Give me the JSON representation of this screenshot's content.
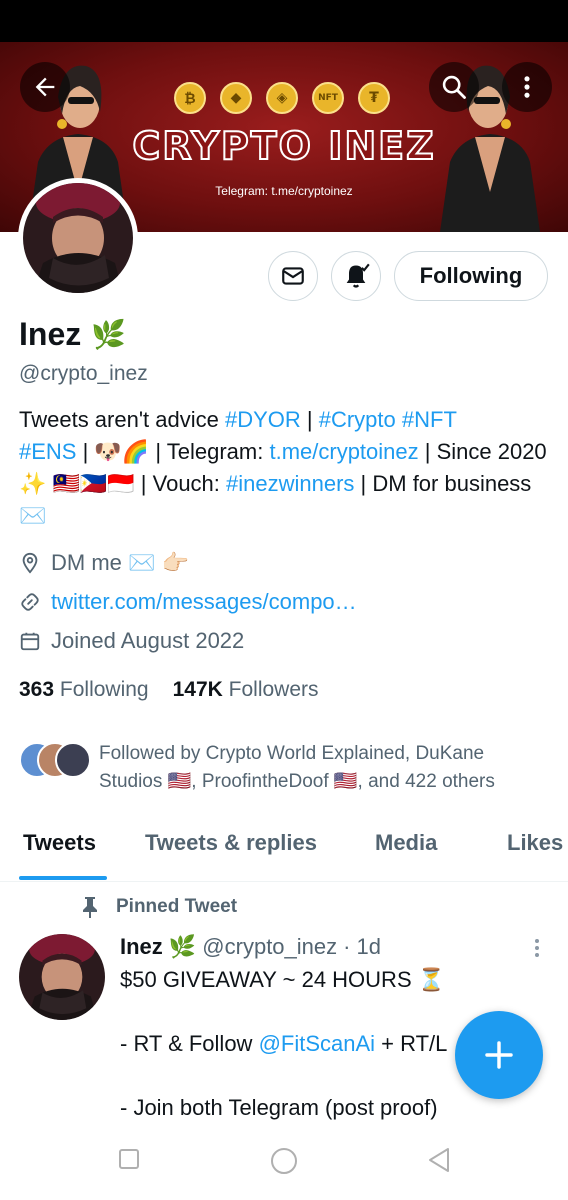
{
  "banner": {
    "title": "CRYPTO INEZ",
    "telegram": "Telegram: t.me/cryptoinez",
    "coins": [
      "₿",
      "◆",
      "◈",
      "NFT",
      "₮"
    ]
  },
  "header": {
    "back_icon": "arrow-left-icon",
    "search_icon": "search-icon",
    "more_icon": "more-vertical-icon"
  },
  "profile": {
    "name": "Inez",
    "name_emoji": "🌿",
    "handle": "@crypto_inez",
    "following_button": "Following",
    "bio": {
      "p1": "Tweets aren't advice ",
      "tag_dyor": "#DYOR",
      "sep1": " | ",
      "tag_crypto": "#Crypto",
      "sp1": " ",
      "tag_nft": "#NFT",
      "tag_ens": "#ENS",
      "p2": " | 🐶🌈 | Telegram: ",
      "link_tg": "t.me/cryptoinez",
      "p3": " | Since 2020 ✨ 🇲🇾🇵🇭🇮🇩 | Vouch: ",
      "tag_winners": "#inezwinners",
      "p4": " | DM for business ✉️"
    },
    "location": "DM me ✉️ 👉🏻",
    "website": "twitter.com/messages/compo…",
    "joined": "Joined August 2022",
    "following_count": "363",
    "following_label": "Following",
    "followers_count": "147K",
    "followers_label": "Followers",
    "followed_by": "Followed by Crypto World Explained, DuKane Studios 🇺🇸, ProofintheDoof 🇺🇸, and 422 others"
  },
  "tabs": [
    "Tweets",
    "Tweets & replies",
    "Media",
    "Likes"
  ],
  "pinned": {
    "label": "Pinned Tweet",
    "name": "Inez 🌿",
    "handle": "@crypto_inez",
    "dot": "·",
    "time": "1d",
    "line1": "$50 GIVEAWAY ~ 24 HOURS ⏳",
    "line2_prefix": "- RT & Follow ",
    "line2_mention": "@FitScanAi",
    "line2_suffix": " + RT/L",
    "line3": "- Join both Telegram (post proof)"
  },
  "colors": {
    "accent": "#1d9bf0",
    "muted": "#536471",
    "text": "#0f1419"
  }
}
